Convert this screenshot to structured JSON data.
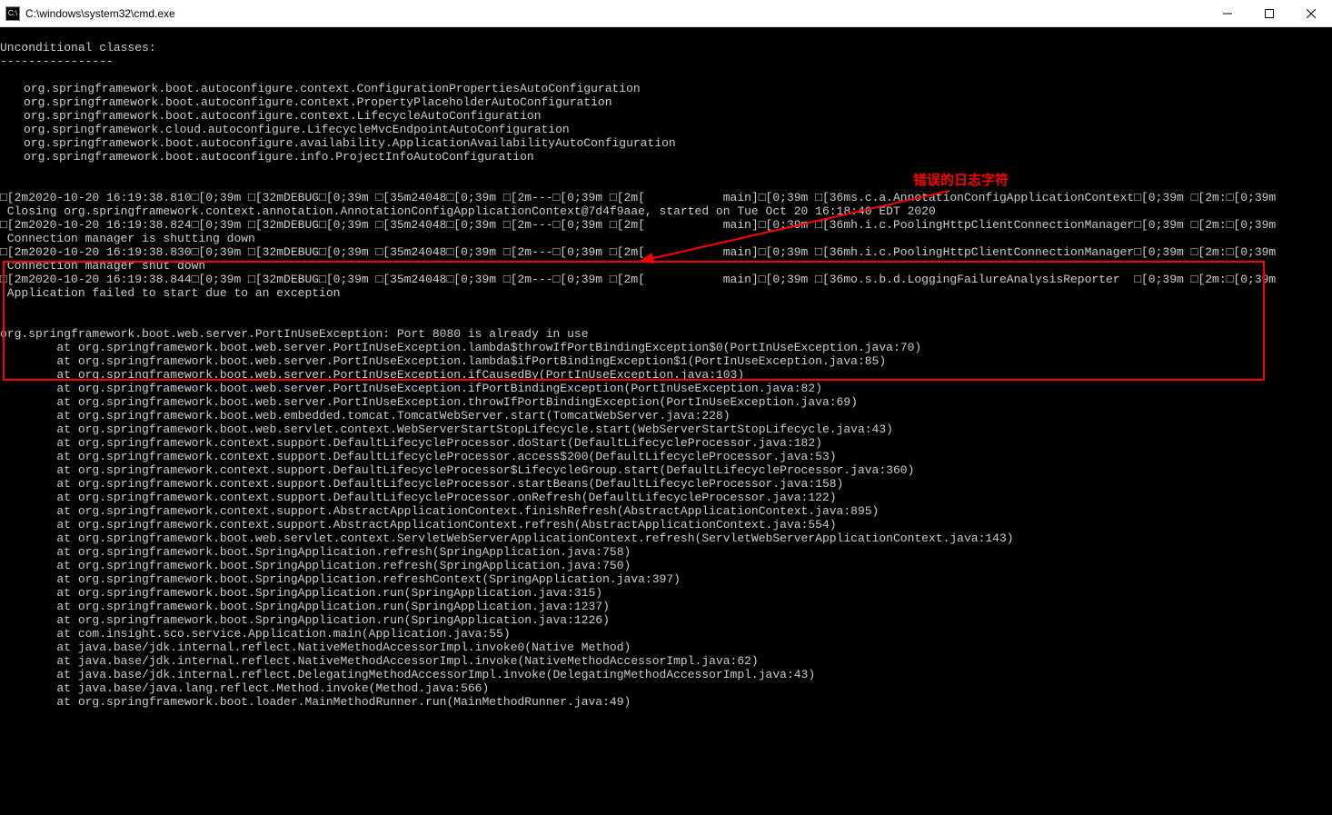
{
  "window": {
    "title": "C:\\windows\\system32\\cmd.exe"
  },
  "annotation": {
    "label": "错误的日志字符"
  },
  "console": {
    "header": "Unconditional classes:",
    "divider": "----------------",
    "classes": [
      "org.springframework.boot.autoconfigure.context.ConfigurationPropertiesAutoConfiguration",
      "org.springframework.boot.autoconfigure.context.PropertyPlaceholderAutoConfiguration",
      "org.springframework.boot.autoconfigure.context.LifecycleAutoConfiguration",
      "org.springframework.cloud.autoconfigure.LifecycleMvcEndpointAutoConfiguration",
      "org.springframework.boot.autoconfigure.availability.ApplicationAvailabilityAutoConfiguration",
      "org.springframework.boot.autoconfigure.info.ProjectInfoAutoConfiguration"
    ],
    "errorLines": [
      "□[2m2020-10-20 16:19:38.810□[0;39m □[32mDEBUG□[0;39m □[35m24048□[0;39m □[2m---□[0;39m □[2m[           main]□[0;39m □[36ms.c.a.AnnotationConfigApplicationContext□[0;39m □[2m:□[0;39m",
      " Closing org.springframework.context.annotation.AnnotationConfigApplicationContext@7d4f9aae, started on Tue Oct 20 16:18:40 EDT 2020",
      "□[2m2020-10-20 16:19:38.824□[0;39m □[32mDEBUG□[0;39m □[35m24048□[0;39m □[2m---□[0;39m □[2m[           main]□[0;39m □[36mh.i.c.PoolingHttpClientConnectionManager□[0;39m □[2m:□[0;39m",
      " Connection manager is shutting down",
      "□[2m2020-10-20 16:19:38.830□[0;39m □[32mDEBUG□[0;39m □[35m24048□[0;39m □[2m---□[0;39m □[2m[           main]□[0;39m □[36mh.i.c.PoolingHttpClientConnectionManager□[0;39m □[2m:□[0;39m",
      " Connection manager shut down",
      "□[2m2020-10-20 16:19:38.844□[0;39m □[32mDEBUG□[0;39m □[35m24048□[0;39m □[2m---□[0;39m □[2m[           main]□[0;39m □[36mo.s.b.d.LoggingFailureAnalysisReporter  □[0;39m □[2m:□[0;39m",
      " Application failed to start due to an exception"
    ],
    "exceptionHeader": "org.springframework.boot.web.server.PortInUseException: Port 8080 is already in use",
    "stackTrace": [
      "at org.springframework.boot.web.server.PortInUseException.lambda$throwIfPortBindingException$0(PortInUseException.java:70)",
      "at org.springframework.boot.web.server.PortInUseException.lambda$ifPortBindingException$1(PortInUseException.java:85)",
      "at org.springframework.boot.web.server.PortInUseException.ifCausedBy(PortInUseException.java:103)",
      "at org.springframework.boot.web.server.PortInUseException.ifPortBindingException(PortInUseException.java:82)",
      "at org.springframework.boot.web.server.PortInUseException.throwIfPortBindingException(PortInUseException.java:69)",
      "at org.springframework.boot.web.embedded.tomcat.TomcatWebServer.start(TomcatWebServer.java:228)",
      "at org.springframework.boot.web.servlet.context.WebServerStartStopLifecycle.start(WebServerStartStopLifecycle.java:43)",
      "at org.springframework.context.support.DefaultLifecycleProcessor.doStart(DefaultLifecycleProcessor.java:182)",
      "at org.springframework.context.support.DefaultLifecycleProcessor.access$200(DefaultLifecycleProcessor.java:53)",
      "at org.springframework.context.support.DefaultLifecycleProcessor$LifecycleGroup.start(DefaultLifecycleProcessor.java:360)",
      "at org.springframework.context.support.DefaultLifecycleProcessor.startBeans(DefaultLifecycleProcessor.java:158)",
      "at org.springframework.context.support.DefaultLifecycleProcessor.onRefresh(DefaultLifecycleProcessor.java:122)",
      "at org.springframework.context.support.AbstractApplicationContext.finishRefresh(AbstractApplicationContext.java:895)",
      "at org.springframework.context.support.AbstractApplicationContext.refresh(AbstractApplicationContext.java:554)",
      "at org.springframework.boot.web.servlet.context.ServletWebServerApplicationContext.refresh(ServletWebServerApplicationContext.java:143)",
      "at org.springframework.boot.SpringApplication.refresh(SpringApplication.java:758)",
      "at org.springframework.boot.SpringApplication.refresh(SpringApplication.java:750)",
      "at org.springframework.boot.SpringApplication.refreshContext(SpringApplication.java:397)",
      "at org.springframework.boot.SpringApplication.run(SpringApplication.java:315)",
      "at org.springframework.boot.SpringApplication.run(SpringApplication.java:1237)",
      "at org.springframework.boot.SpringApplication.run(SpringApplication.java:1226)",
      "at com.insight.sco.service.Application.main(Application.java:55)",
      "at java.base/jdk.internal.reflect.NativeMethodAccessorImpl.invoke0(Native Method)",
      "at java.base/jdk.internal.reflect.NativeMethodAccessorImpl.invoke(NativeMethodAccessorImpl.java:62)",
      "at java.base/jdk.internal.reflect.DelegatingMethodAccessorImpl.invoke(DelegatingMethodAccessorImpl.java:43)",
      "at java.base/java.lang.reflect.Method.invoke(Method.java:566)",
      "at org.springframework.boot.loader.MainMethodRunner.run(MainMethodRunner.java:49)"
    ]
  }
}
